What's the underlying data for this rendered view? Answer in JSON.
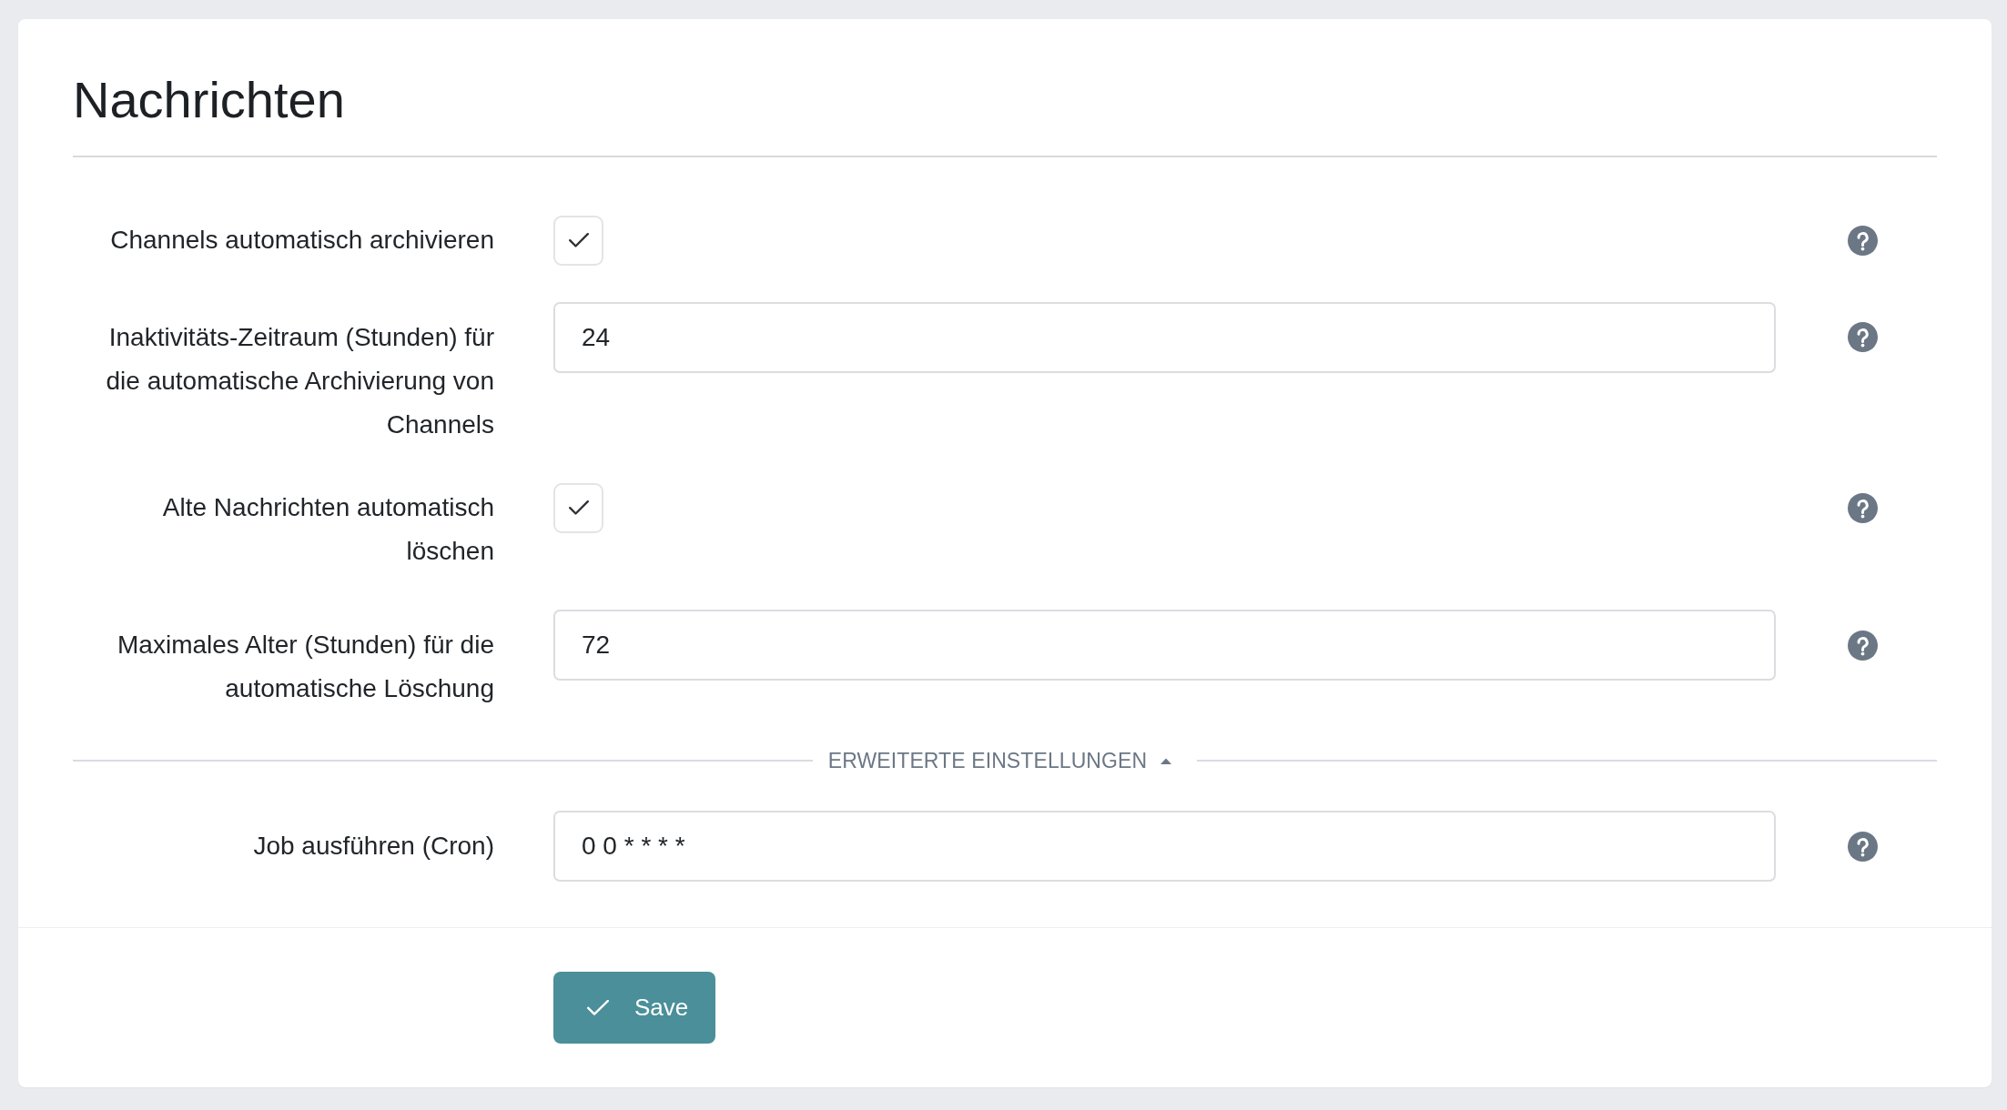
{
  "section": {
    "title": "Nachrichten"
  },
  "settings": [
    {
      "kind": "checkbox",
      "label": "Channels automatisch archivieren",
      "checked": true
    },
    {
      "kind": "input",
      "label": "Inaktivitäts-Zeitraum (Stunden) für die automatische Archivierung von Channels",
      "value": "24"
    },
    {
      "kind": "checkbox",
      "label": "Alte Nachrichten automatisch löschen",
      "checked": true
    },
    {
      "kind": "input",
      "label": "Maximales Alter (Stunden) für die automatische Löschung",
      "value": "72"
    }
  ],
  "advanced": {
    "label": "ERWEITERTE EINSTELLUNGEN",
    "expanded": true,
    "settings": [
      {
        "kind": "input",
        "label": "Job ausführen (Cron)",
        "value": "0 0 * * * *"
      }
    ]
  },
  "save_button": {
    "label": "Save"
  }
}
